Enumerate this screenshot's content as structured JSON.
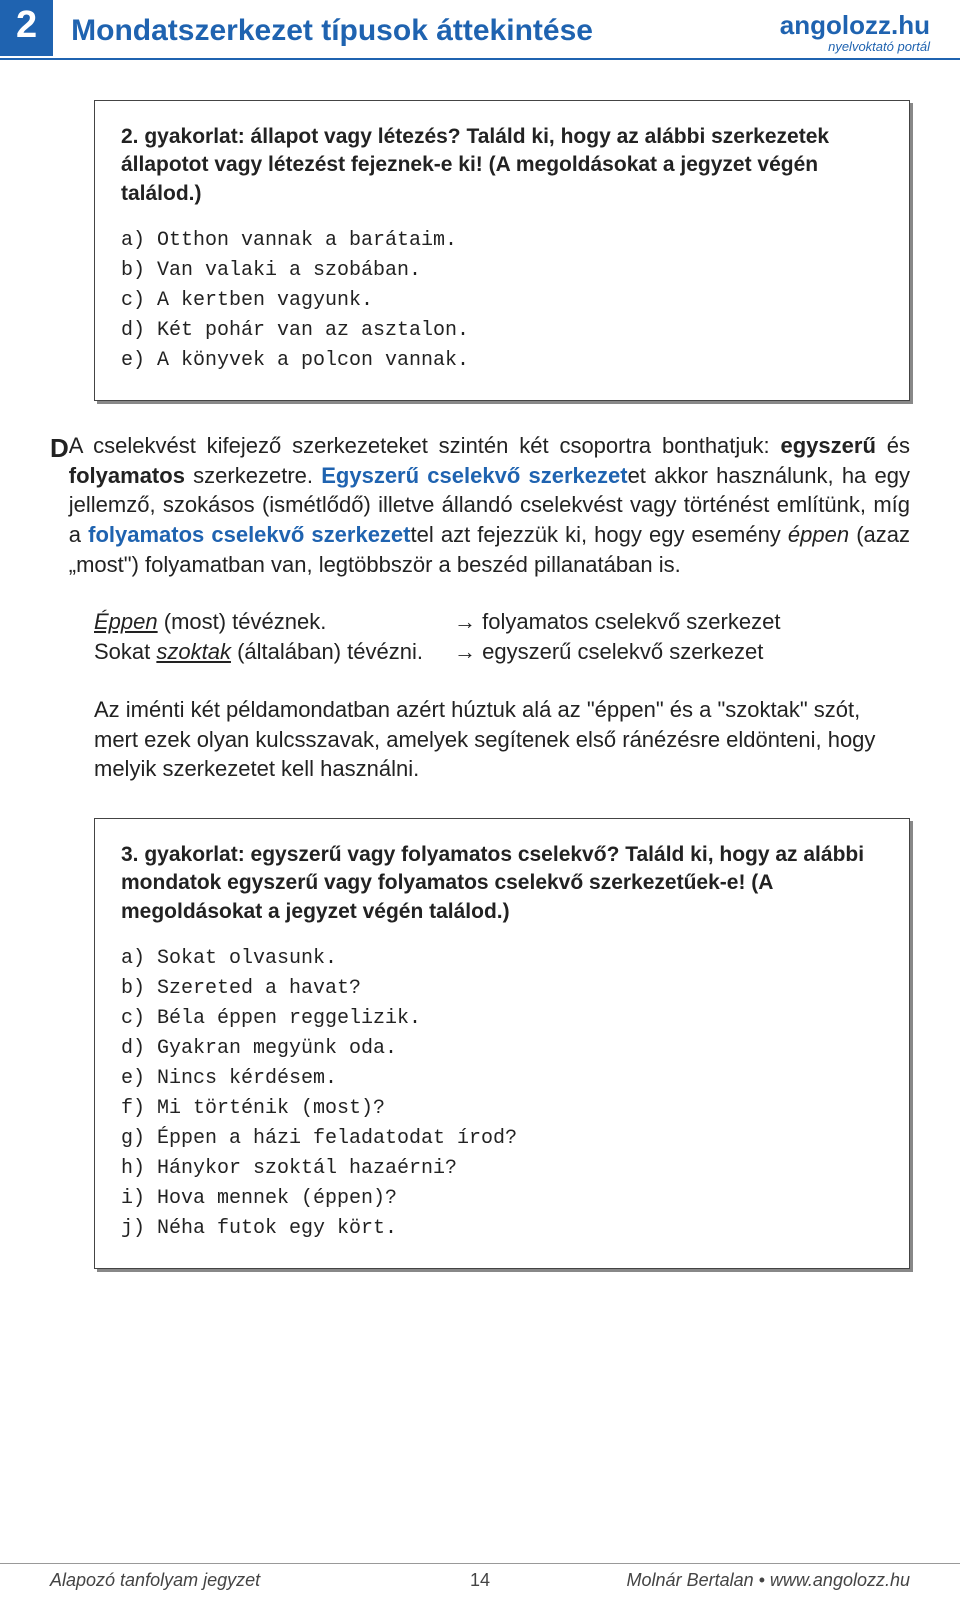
{
  "header": {
    "chapter_num": "2",
    "chapter_title": "Mondatszerkezet típusok áttekintése",
    "brand_main": "angolozz.hu",
    "brand_sub": "nyelvoktató portál"
  },
  "box2": {
    "title": "2. gyakorlat: állapot vagy létezés? Találd ki, hogy az alábbi szerkezetek állapotot vagy létezést fejeznek-e ki! (A megoldásokat a jegyzet végén találod.)",
    "items": "a) Otthon vannak a barátaim.\nb) Van valaki a szobában.\nc) A kertben vagyunk.\nd) Két pohár van az asztalon.\ne) A könyvek a polcon vannak."
  },
  "sectionD": {
    "marker": "D",
    "p_pre": "A cselekvést kifejező szerkezeteket szintén két csoportra bonthatjuk: ",
    "p_bold1": "egyszerű",
    "p_mid1": " és ",
    "p_bold2": "folyamatos",
    "p_mid2": " szerkezetre. ",
    "p_blue1": "Egyszerű cselekvő szerkezet",
    "p_mid3": "et akkor használunk, ha egy jellemző, szokásos (ismétlődő) illetve állandó cselekvést vagy történést említünk, míg a ",
    "p_blue2": "folyamatos cselekvő szerkezet",
    "p_mid4": "tel azt fejezzük ki, hogy egy esemény ",
    "p_ital1": "éppen",
    "p_mid5": " (azaz „most\") folyamatban van, legtöbbször a beszéd pillanatában is."
  },
  "examples": {
    "r1_left_u": "Éppen",
    "r1_left_tail": " (most) tévéznek.",
    "r1_right": "→  folyamatos cselekvő szerkezet",
    "r2_left_pre": "Sokat ",
    "r2_left_u": "szoktak",
    "r2_left_tail": " (általában) tévézni.",
    "r2_right": "→  egyszerű cselekvő szerkezet"
  },
  "plain": "Az iménti két példamondatban azért húztuk alá az \"éppen\" és a \"szoktak\" szót, mert ezek olyan kulcsszavak, amelyek segítenek első ránézésre eldönteni, hogy melyik szerkezetet kell használni.",
  "box3": {
    "title": "3. gyakorlat: egyszerű vagy folyamatos cselekvő? Találd ki, hogy az alábbi mondatok egyszerű vagy folyamatos cselekvő szerkezetűek-e! (A megoldásokat a jegyzet végén találod.)",
    "items": "a) Sokat olvasunk.\nb) Szereted a havat?\nc) Béla éppen reggelizik.\nd) Gyakran megyünk oda.\ne) Nincs kérdésem.\nf) Mi történik (most)?\ng) Éppen a házi feladatodat írod?\nh) Hánykor szoktál hazaérni?\ni) Hova mennek (éppen)?\nj) Néha futok egy kört."
  },
  "footer": {
    "left": "Alapozó tanfolyam jegyzet",
    "mid": "14",
    "right": "Molnár Bertalan • www.angolozz.hu"
  }
}
